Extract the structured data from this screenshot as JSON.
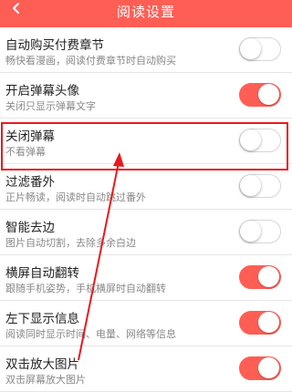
{
  "header": {
    "title": "阅读设置",
    "back_icon": "chevron-left-icon",
    "background": "#ff5e55"
  },
  "settings": [
    {
      "title": "自动购买付费章节",
      "subtitle": "畅快看漫画，阅读付费章节时自动购买",
      "enabled": false
    },
    {
      "title": "开启弹幕头像",
      "subtitle": "关闭只显示弹幕文字",
      "enabled": true
    },
    {
      "title": "关闭弹幕",
      "subtitle": "不看弹幕",
      "enabled": false
    },
    {
      "title": "过滤番外",
      "subtitle": "正片畅读，阅读时自动跳过番外",
      "enabled": false
    },
    {
      "title": "智能去边",
      "subtitle": "图片自动切割，去除多余白边",
      "enabled": false
    },
    {
      "title": "横屏自动翻转",
      "subtitle": "跟随手机姿势，手机横屏时自动翻转",
      "enabled": true
    },
    {
      "title": "左下显示信息",
      "subtitle": "阅读同时显示时间、电量、网络等信息",
      "enabled": true
    },
    {
      "title": "双击放大图片",
      "subtitle": "双击屏幕放大图片",
      "enabled": true
    }
  ],
  "annotation": {
    "highlight_color": "#e8191e",
    "highlighted_item": "关闭弹幕"
  },
  "colors": {
    "accent": "#ff5e55",
    "toggle_off_border": "#d6d6d6"
  }
}
